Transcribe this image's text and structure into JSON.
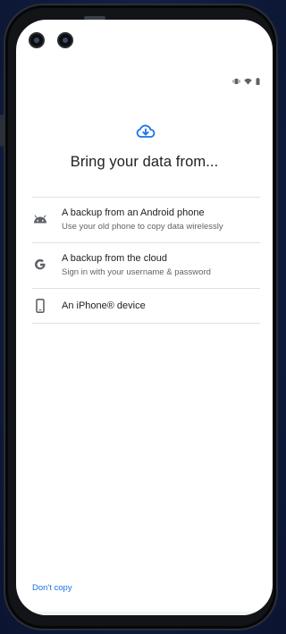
{
  "status_bar": {
    "icons": [
      "vibrate-icon",
      "wifi-icon",
      "battery-icon"
    ]
  },
  "header": {
    "icon": "cloud-download-icon",
    "title": "Bring your data from..."
  },
  "options": [
    {
      "icon": "android-icon",
      "title": "A backup from an Android phone",
      "subtitle": "Use your old phone to copy data wirelessly"
    },
    {
      "icon": "google-g-icon",
      "title": "A backup from the cloud",
      "subtitle": "Sign in with your username & password"
    },
    {
      "icon": "phone-icon",
      "title": "An iPhone® device",
      "subtitle": ""
    }
  ],
  "footer": {
    "dont_copy_label": "Don't copy"
  },
  "colors": {
    "accent": "#1a73e8",
    "text_primary": "#202124",
    "text_secondary": "#5f6368"
  }
}
